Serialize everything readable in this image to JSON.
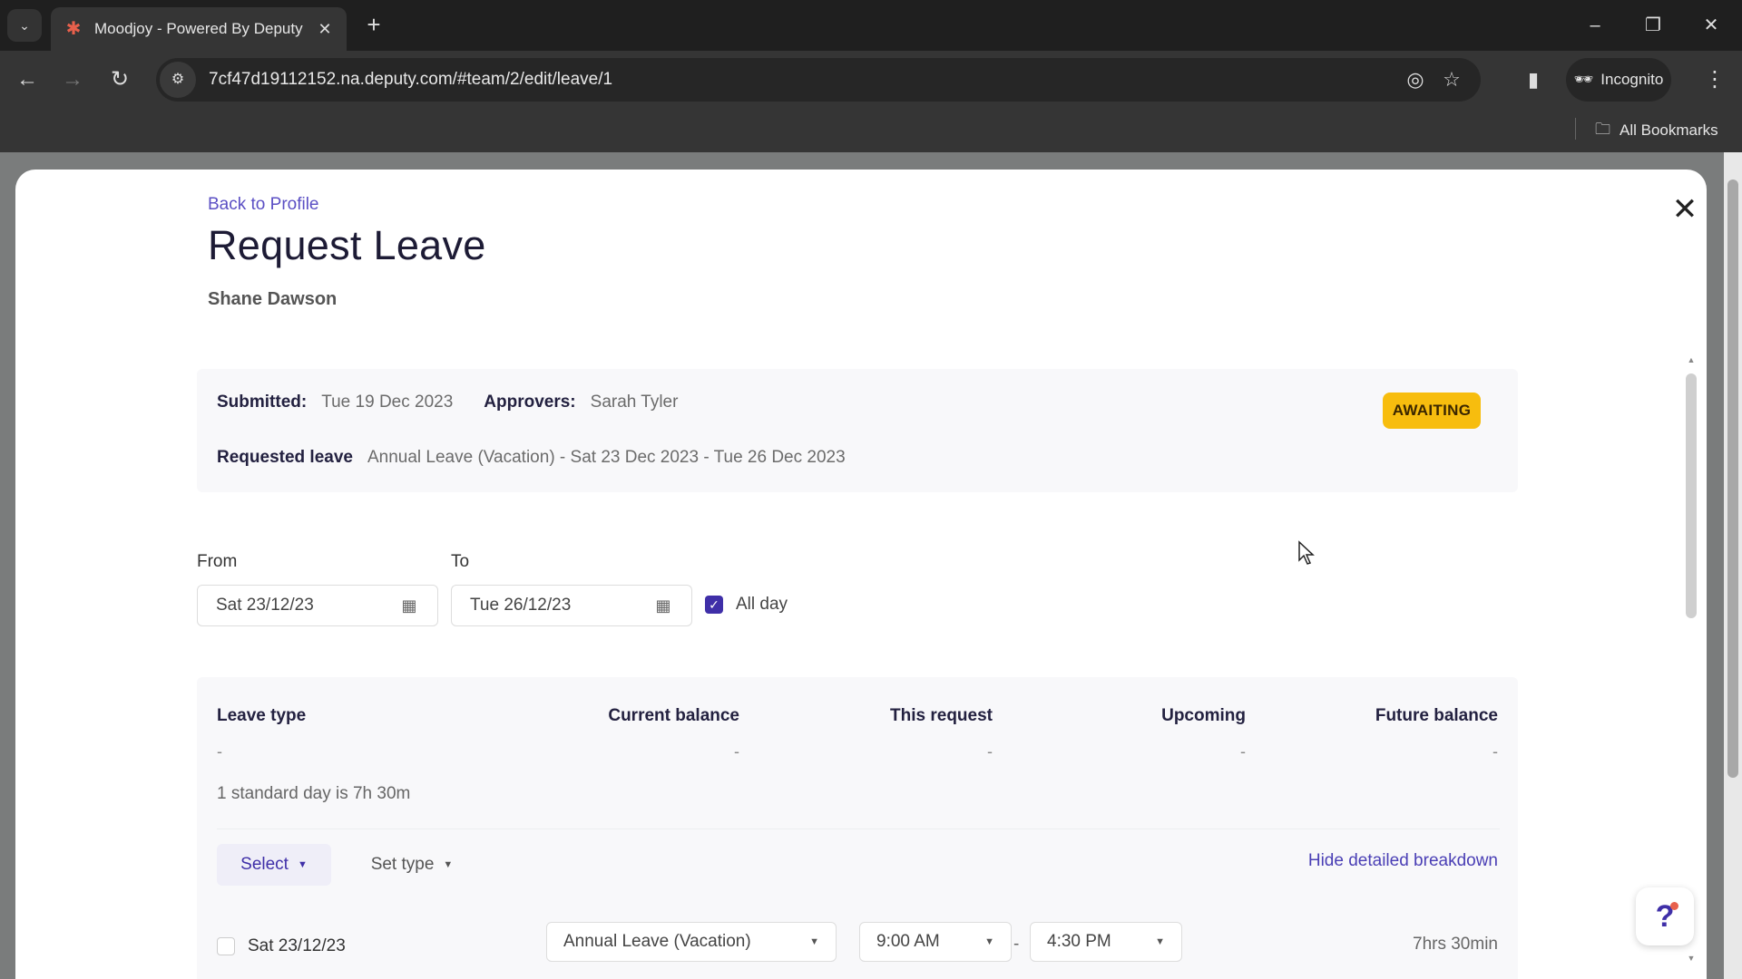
{
  "browser": {
    "tab_title": "Moodjoy - Powered By Deputy",
    "url": "7cf47d19112152.na.deputy.com/#team/2/edit/leave/1",
    "profile_label": "Incognito",
    "bookmarks_label": "All Bookmarks"
  },
  "modal": {
    "back_link": "Back to Profile",
    "title": "Request Leave",
    "employee_name": "Shane Dawson",
    "summary": {
      "submitted_label": "Submitted:",
      "submitted_value": "Tue 19 Dec 2023",
      "approvers_label": "Approvers:",
      "approvers_value": "Sarah Tyler",
      "requested_label": "Requested leave",
      "requested_value": "Annual Leave (Vacation) - Sat 23 Dec 2023 - Tue 26 Dec 2023",
      "status": "AWAITING",
      "status_color": "#f7bd0e"
    },
    "from_label": "From",
    "from_value": "Sat 23/12/23",
    "to_label": "To",
    "to_value": "Tue 26/12/23",
    "all_day_label": "All day",
    "all_day_checked": true,
    "breakdown": {
      "headers": [
        "Leave type",
        "Current balance",
        "This request",
        "Upcoming",
        "Future balance"
      ],
      "values": [
        "-",
        "-",
        "-",
        "-",
        "-"
      ],
      "standard_day_note": "1 standard day is 7h 30m",
      "select_label": "Select",
      "set_type_label": "Set type",
      "hide_link": "Hide detailed breakdown",
      "rows": [
        {
          "date": "Sat 23/12/23",
          "leave_type": "Annual Leave (Vacation)",
          "start_time": "9:00 AM",
          "end_time": "4:30 PM",
          "separator": "-",
          "duration": "7hrs 30min"
        }
      ]
    },
    "help_label": "?"
  },
  "colors": {
    "accent": "#3f2fa8",
    "link": "#5b4fc4"
  }
}
